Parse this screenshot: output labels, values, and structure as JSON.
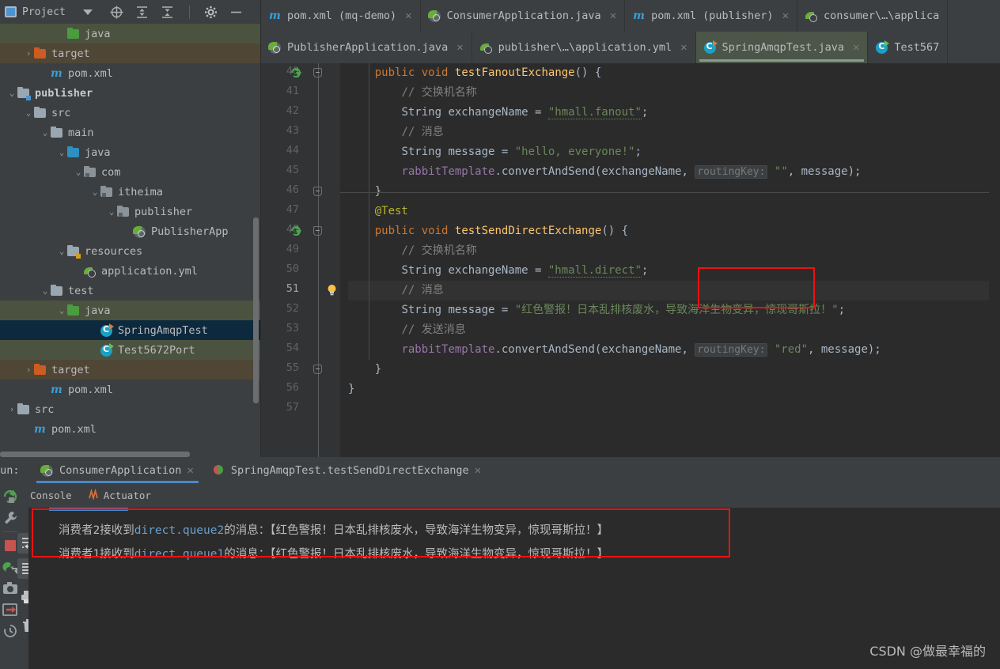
{
  "project_panel": {
    "title": "Project",
    "icons": [
      "project-view-icon",
      "caret-down-icon",
      "locate-icon",
      "expand-all-icon",
      "collapse-all-icon",
      "settings-gear-icon",
      "hide-icon"
    ],
    "tree": [
      {
        "indent": 4,
        "arrow": "",
        "icon": "folder-green",
        "label": "java",
        "style": "green"
      },
      {
        "indent": 2,
        "arrow": "›",
        "icon": "folder-orange",
        "label": "target",
        "style": "brown"
      },
      {
        "indent": 3,
        "arrow": "",
        "icon": "maven-m",
        "label": "pom.xml",
        "style": ""
      },
      {
        "indent": 1,
        "arrow": "⌄",
        "icon": "folder-module",
        "label": "publisher",
        "style": "",
        "bold": true
      },
      {
        "indent": 2,
        "arrow": "⌄",
        "icon": "folder-gray",
        "label": "src",
        "style": ""
      },
      {
        "indent": 3,
        "arrow": "⌄",
        "icon": "folder-gray",
        "label": "main",
        "style": ""
      },
      {
        "indent": 4,
        "arrow": "⌄",
        "icon": "folder-blue",
        "label": "java",
        "style": ""
      },
      {
        "indent": 5,
        "arrow": "⌄",
        "icon": "folder-package",
        "label": "com",
        "style": ""
      },
      {
        "indent": 6,
        "arrow": "⌄",
        "icon": "folder-package",
        "label": "itheima",
        "style": ""
      },
      {
        "indent": 7,
        "arrow": "⌄",
        "icon": "folder-package",
        "label": "publisher",
        "style": ""
      },
      {
        "indent": 8,
        "arrow": "",
        "icon": "spring-class",
        "label": "PublisherApp",
        "style": ""
      },
      {
        "indent": 4,
        "arrow": "⌄",
        "icon": "folder-resources",
        "label": "resources",
        "style": ""
      },
      {
        "indent": 5,
        "arrow": "",
        "icon": "yml-leaf",
        "label": "application.yml",
        "style": ""
      },
      {
        "indent": 3,
        "arrow": "⌄",
        "icon": "folder-gray",
        "label": "test",
        "style": ""
      },
      {
        "indent": 4,
        "arrow": "⌄",
        "icon": "folder-green",
        "label": "java",
        "style": "green"
      },
      {
        "indent": 6,
        "arrow": "",
        "icon": "test-class-orange",
        "label": "SpringAmqpTest",
        "style": "sel"
      },
      {
        "indent": 6,
        "arrow": "",
        "icon": "test-class-green",
        "label": "Test5672Port",
        "style": "green"
      },
      {
        "indent": 2,
        "arrow": "›",
        "icon": "folder-orange",
        "label": "target",
        "style": "brown"
      },
      {
        "indent": 3,
        "arrow": "",
        "icon": "maven-m",
        "label": "pom.xml",
        "style": ""
      },
      {
        "indent": 1,
        "arrow": "›",
        "icon": "folder-gray",
        "label": "src",
        "style": ""
      },
      {
        "indent": 2,
        "arrow": "",
        "icon": "maven-m",
        "label": "pom.xml",
        "style": ""
      }
    ]
  },
  "editor": {
    "tabs_row1": [
      {
        "label": "pom.xml (mq-demo)",
        "icon": "maven-m",
        "closable": true,
        "active": false
      },
      {
        "label": "ConsumerApplication.java",
        "icon": "spring-class",
        "closable": true,
        "active": false
      },
      {
        "label": "pom.xml (publisher)",
        "icon": "maven-m",
        "closable": true,
        "active": false
      },
      {
        "label": "consumer\\…\\applica",
        "icon": "yml-leaf",
        "closable": false,
        "active": false
      }
    ],
    "tabs_row2": [
      {
        "label": "PublisherApplication.java",
        "icon": "spring-class",
        "closable": true,
        "active": false
      },
      {
        "label": "publisher\\…\\application.yml",
        "icon": "yml-leaf",
        "closable": true,
        "active": false
      },
      {
        "label": "SpringAmqpTest.java",
        "icon": "test-class-orange",
        "closable": true,
        "active": true
      },
      {
        "label": "Test567",
        "icon": "test-class-green",
        "closable": false,
        "active": false
      }
    ],
    "first_line_number": 40,
    "lines": [
      {
        "n": 40,
        "run_marker": true,
        "fold": true,
        "html": "    <span class='kw'>public</span> <span class='kw'>void</span> <span class='mth'>testFanoutExchange</span><span class='pun'>() {</span>"
      },
      {
        "n": 41,
        "html": "        <span class='cmt'>// 交换机名称</span>"
      },
      {
        "n": 42,
        "html": "        <span class='pun'>String exchangeName = </span><span class='str squig'>\"hmall.fanout\"</span><span class='pun'>;</span>"
      },
      {
        "n": 43,
        "html": "        <span class='cmt'>// 消息</span>"
      },
      {
        "n": 44,
        "html": "        <span class='pun'>String message = </span><span class='str'>\"hello, everyone!\"</span><span class='pun'>;</span>"
      },
      {
        "n": 45,
        "html": "        <span class='fld'>rabbitTemplate</span><span class='pun'>.convertAndSend(exchangeName, </span><span class='hintparam'>routingKey:</span> <span class='str'>\"\"</span><span class='pun'>, message);</span>"
      },
      {
        "n": 46,
        "fold": true,
        "html": "    <span class='pun'>}</span>"
      },
      {
        "n": 47,
        "html": "    <span class='anno'>@Test</span>"
      },
      {
        "n": 48,
        "run_marker": true,
        "fold": true,
        "html": "    <span class='kw'>public</span> <span class='kw'>void</span> <span class='mth'>testSendDirectExchange</span><span class='pun'>() {</span>"
      },
      {
        "n": 49,
        "html": "        <span class='cmt'>// 交换机名称</span>"
      },
      {
        "n": 50,
        "html": "        <span class='pun'>String exchangeName = </span><span class='str squig'>\"hmall.direct\"</span><span class='pun'>;</span>"
      },
      {
        "n": 51,
        "current": true,
        "bulb": true,
        "html": "        <span class='cmt'>// 消息</span>"
      },
      {
        "n": 52,
        "html": "        <span class='pun'>String message = </span><span class='str'>\"红色警报！日本乱排核废水，导致海洋生物变异，惊现哥斯拉！\"</span><span class='pun'>;</span>"
      },
      {
        "n": 53,
        "html": "        <span class='cmt'>// 发送消息</span>"
      },
      {
        "n": 54,
        "html": "        <span class='fld'>rabbitTemplate</span><span class='pun'>.convertAndSend(exchangeName, </span><span class='hintparam'>routingKey:</span> <span class='str'>\"red\"</span><span class='pun'>, message);</span>"
      },
      {
        "n": 55,
        "fold": true,
        "html": "    <span class='pun'>}</span>"
      },
      {
        "n": 56,
        "html": "<span class='pun'>}</span>"
      },
      {
        "n": 57,
        "html": ""
      }
    ]
  },
  "run_panel": {
    "run_label": "Run:",
    "tabs": [
      {
        "label": "ConsumerApplication",
        "icon": "spring-leaf-icon",
        "active": true,
        "closable": true
      },
      {
        "label": "SpringAmqpTest.testSendDirectExchange",
        "icon": "test-run-icon",
        "active": false,
        "closable": true
      }
    ],
    "subtabs": [
      {
        "label": "Console",
        "icon": ""
      },
      {
        "label": "Actuator",
        "icon": "actuator-icon"
      }
    ],
    "rail_icons": [
      "rerun-icon",
      "wrench-icon",
      "stop-icon",
      "thread-dump-icon",
      "camera-icon",
      "exit-icon",
      "history-icon"
    ],
    "console_rail_icons": [
      "soft-wrap-icon",
      "scroll-to-end-icon",
      "print-icon",
      "trash-icon"
    ],
    "console_lines": [
      {
        "prefix": "消费者2接收到",
        "mono": "direct.queue2",
        "suffix": "的消息：【红色警报！日本乱排核废水，导致海洋生物变异，惊现哥斯拉！】"
      },
      {
        "prefix": "消费者1接收到",
        "mono": "direct.queue1",
        "suffix": "的消息：【红色警报！日本乱排核废水，导致海洋生物变异，惊现哥斯拉！】"
      }
    ]
  },
  "watermark": "CSDN @做最幸福的",
  "colors": {
    "accent_blue": "#4a88c7",
    "highlight_red": "#ee1111",
    "editor_bg": "#2b2b2b",
    "panel_bg": "#3c3f41",
    "selection": "#0d293e",
    "green_row": "#4b5340",
    "brown_row": "#4f4636"
  }
}
